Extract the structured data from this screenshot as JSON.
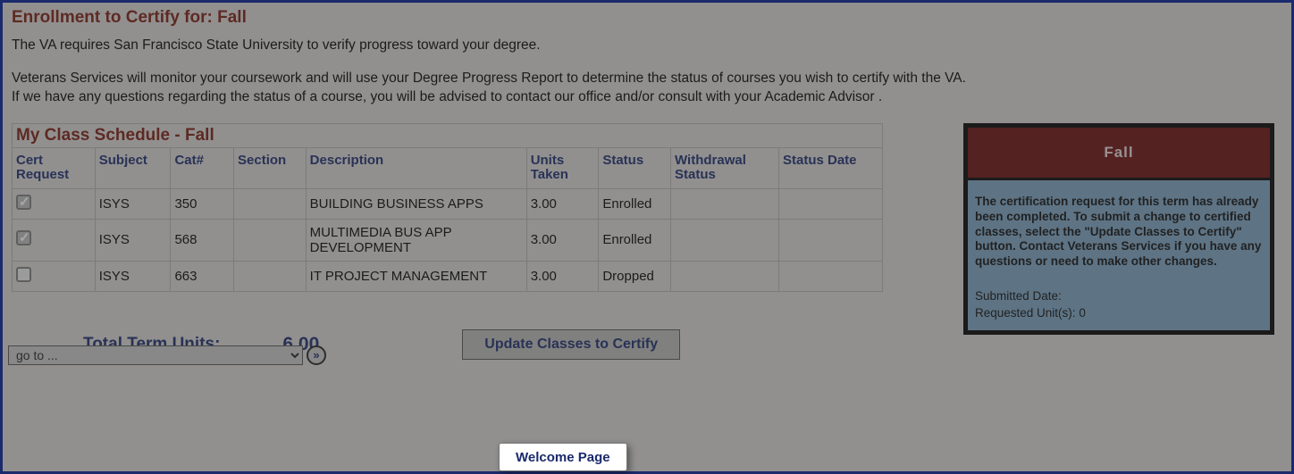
{
  "heading": "Enrollment to Certify for: Fall",
  "intro_line1": "The VA requires San Francisco State University to verify progress toward your degree.",
  "intro_line2": "Veterans Services will monitor your coursework and will use your Degree Progress Report to determine the status of courses you wish to certify with the VA.",
  "intro_line3": "If we have any questions regarding the status of a course, you will be advised to contact our office and/or consult with your Academic Advisor .",
  "schedule_title": "My Class Schedule - Fall",
  "columns": {
    "cert": "Cert Request",
    "subject": "Subject",
    "cat": "Cat#",
    "section": "Section",
    "description": "Description",
    "units": "Units Taken",
    "status": "Status",
    "wd": "Withdrawal Status",
    "sd": "Status Date"
  },
  "rows": [
    {
      "checked": true,
      "subject": "ISYS",
      "cat": "350",
      "section": "",
      "description": "BUILDING BUSINESS APPS",
      "units": "3.00",
      "status": "Enrolled",
      "wd": "",
      "sd": ""
    },
    {
      "checked": true,
      "subject": "ISYS",
      "cat": "568",
      "section": "",
      "description": "MULTIMEDIA BUS APP DEVELOPMENT",
      "units": "3.00",
      "status": "Enrolled",
      "wd": "",
      "sd": ""
    },
    {
      "checked": false,
      "subject": "ISYS",
      "cat": "663",
      "section": "",
      "description": "IT PROJECT MANAGEMENT",
      "units": "3.00",
      "status": "Dropped",
      "wd": "",
      "sd": ""
    }
  ],
  "totals_label": "Total Term Units:",
  "totals_value": "6.00",
  "update_button": "Update Classes to Certify",
  "side": {
    "term_label": "Fall",
    "message": "The certification request for this term has already been completed. To submit a change to certified classes, select the \"Update Classes to Certify\" button. Contact Veterans Services if you have any questions or need to make other changes.",
    "submitted_label": "Submitted Date:",
    "submitted_value": "",
    "requested_label": "Requested Unit(s):",
    "requested_value": "0"
  },
  "goto": {
    "placeholder": "go to ...",
    "arrow": "»"
  },
  "welcome_button": "Welcome Page"
}
